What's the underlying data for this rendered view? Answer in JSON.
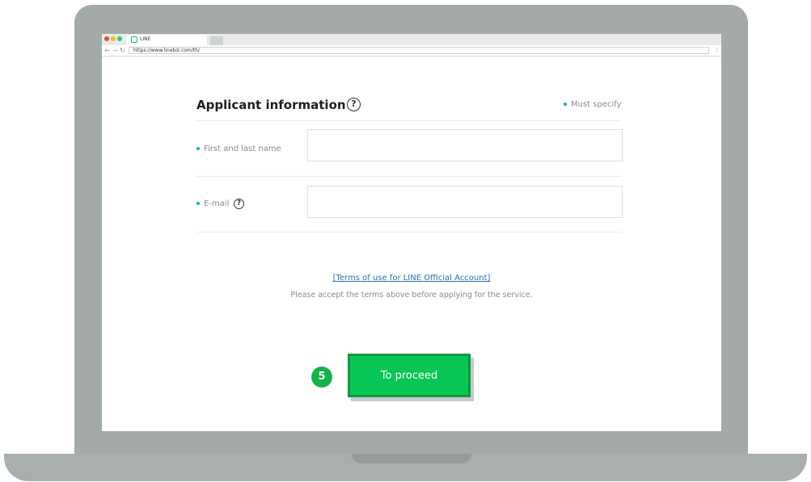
{
  "browser": {
    "tab_title": "LINE",
    "url": "https://www.linebiz.com/th/"
  },
  "form": {
    "title": "Applicant information",
    "help_symbol": "?",
    "must_specify": "Must specify",
    "fields": [
      {
        "label": "First and last name",
        "value": "",
        "placeholder": ""
      },
      {
        "label": "E-mail",
        "value": "",
        "placeholder": ""
      }
    ]
  },
  "terms": {
    "link_text": "[Terms of use for LINE Official Account]",
    "note": "Please accept the terms above before applying for the service."
  },
  "step_badge": "5",
  "proceed_button": "To proceed",
  "colors": {
    "accent": "#06c755",
    "button_border": "#0b9a3c",
    "badge": "#13b34a",
    "link": "#2f6db4",
    "laptop_frame": "#a4aaa7"
  }
}
